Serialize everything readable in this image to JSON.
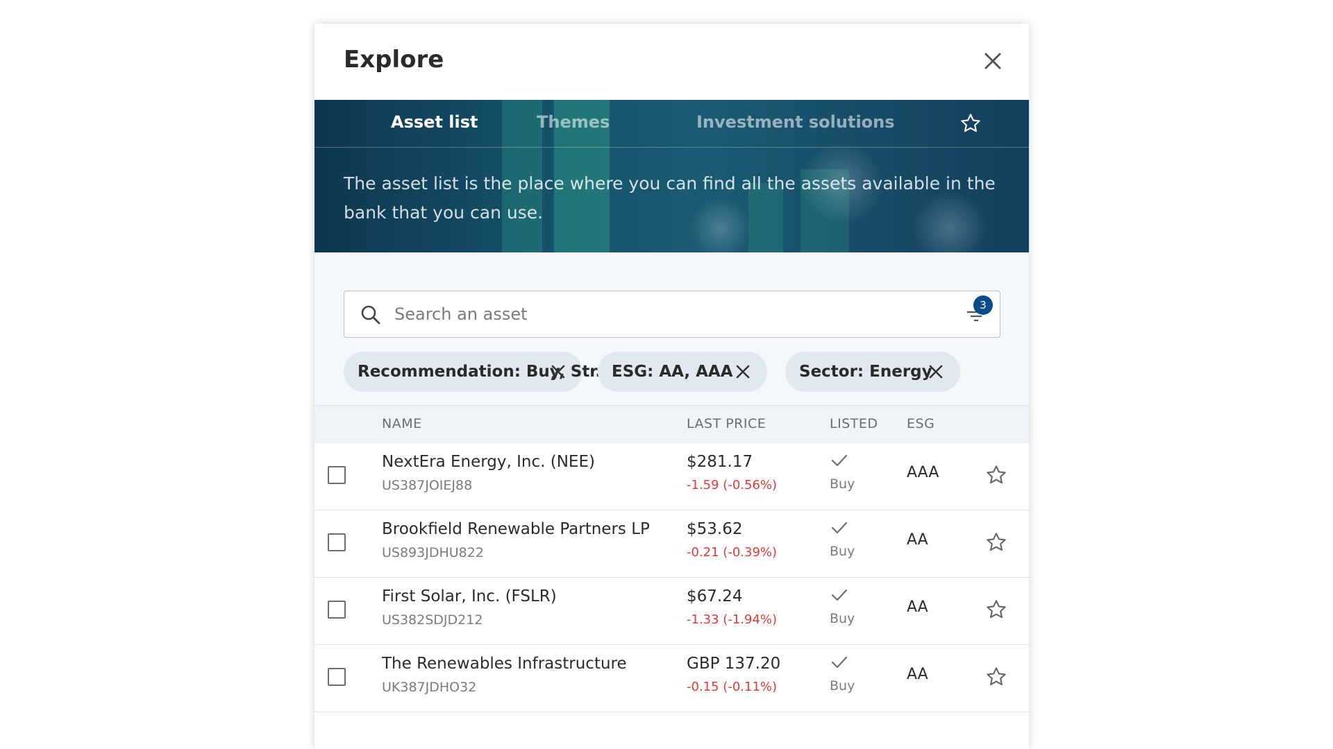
{
  "dialog": {
    "title": "Explore"
  },
  "tabs": [
    {
      "label": "Asset list",
      "active": true
    },
    {
      "label": "Themes",
      "active": false
    },
    {
      "label": "Investment solutions",
      "active": false
    }
  ],
  "banner": {
    "description": "The asset list is the place where you can find all the assets available in the bank that you can use."
  },
  "search": {
    "placeholder": "Search an asset",
    "value": "",
    "filter_count": "3"
  },
  "filters": [
    {
      "label": "Recommendation:  Buy, Str..."
    },
    {
      "label": "ESG:  AA, AAA"
    },
    {
      "label": "Sector: Energy"
    }
  ],
  "table": {
    "headers": {
      "name": "NAME",
      "last_price": "LAST PRICE",
      "listed": "LISTED",
      "esg": "ESG"
    },
    "rows": [
      {
        "name": "NextEra Energy, Inc. (NEE)",
        "isin": "US387JOIEJ88",
        "price": "$281.17",
        "change": "-1.59 (-0.56%)",
        "listed": "Buy",
        "esg": "AAA"
      },
      {
        "name": "Brookfield Renewable Partners LP",
        "isin": "US893JDHU822",
        "price": "$53.62",
        "change": "-0.21 (-0.39%)",
        "listed": "Buy",
        "esg": "AA"
      },
      {
        "name": "First Solar, Inc. (FSLR)",
        "isin": "US382SDJD212",
        "price": "$67.24",
        "change": "-1.33 (-1.94%)",
        "listed": "Buy",
        "esg": "AA"
      },
      {
        "name": "The Renewables Infrastructure",
        "isin": "UK387JDHO32",
        "price": "GBP 137.20",
        "change": "-0.15 (-0.11%)",
        "listed": "Buy",
        "esg": "AA"
      }
    ]
  },
  "colors": {
    "accent": "#0b4a8b",
    "negative": "#e53935",
    "banner": "#15506a",
    "chip": "#e1e8ef"
  },
  "icons": {
    "close": "close-icon",
    "favorites": "star-icon",
    "search": "search-icon",
    "filter": "filter-icon",
    "listed": "check-icon"
  }
}
